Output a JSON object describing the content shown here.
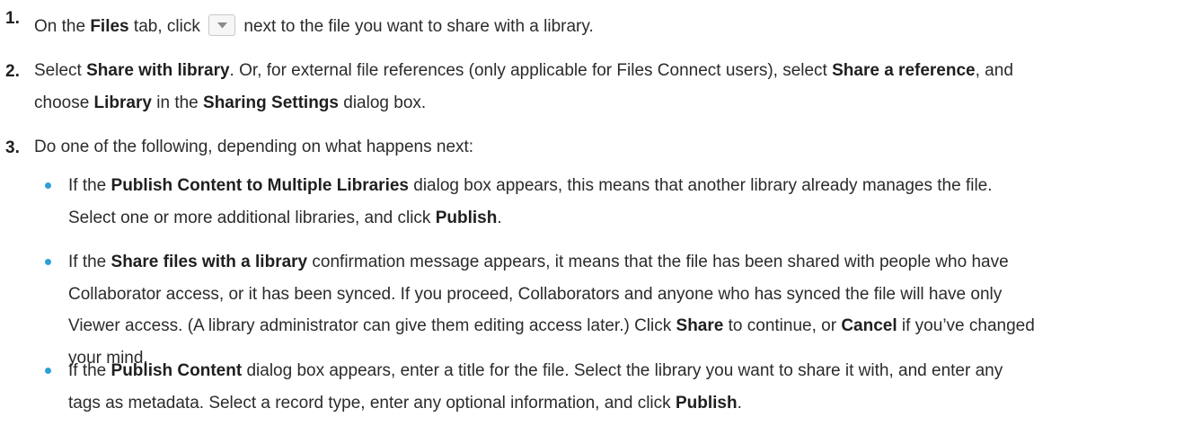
{
  "steps": [
    {
      "num": "1.",
      "a": "On the ",
      "b1": "Files",
      "c": " tab, click ",
      "d": " next to the file you want to share with a library."
    },
    {
      "num": "2.",
      "l1_a": "Select ",
      "l1_b1": "Share with library",
      "l1_c": ". Or, for external file references (only applicable for Files Connect users), select ",
      "l1_b2": "Share a reference",
      "l1_d": ", and",
      "l2_a": "choose ",
      "l2_b1": "Library",
      "l2_c": " in the ",
      "l2_b2": "Sharing Settings",
      "l2_d": " dialog box."
    },
    {
      "num": "3.",
      "text": "Do one of the following, depending on what happens next:"
    }
  ],
  "bullets": [
    {
      "l1_a": "If the ",
      "l1_b": "Publish Content to Multiple Libraries",
      "l1_c": " dialog box appears, this means that another library already manages the file.",
      "l2_a": "Select one or more additional libraries, and click ",
      "l2_b": "Publish",
      "l2_c": "."
    },
    {
      "l1_a": "If the ",
      "l1_b": "Share files with a library",
      "l1_c": " confirmation message appears, it means that the file has been shared with people who have",
      "l2": "Collaborator access, or it has been synced. If you proceed, Collaborators and anyone who has synced the file will have only",
      "l3_a": "Viewer access. (A library administrator can give them editing access later.) Click ",
      "l3_b1": "Share",
      "l3_c": " to continue, or ",
      "l3_b2": "Cancel",
      "l3_d": " if you’ve changed",
      "l4": "your mind."
    },
    {
      "l1_a": "If the ",
      "l1_b": "Publish Content",
      "l1_c": " dialog box appears, enter a title for the file. Select the library you want to share it with, and enter any",
      "l2_a": "tags as metadata. Select a record type, enter any optional information, and click ",
      "l2_b": "Publish",
      "l2_c": "."
    }
  ],
  "icons": {
    "dropdown": "chevron-down-icon"
  },
  "colors": {
    "bullet": "#2e9fd8",
    "text": "#2b2b2b"
  }
}
